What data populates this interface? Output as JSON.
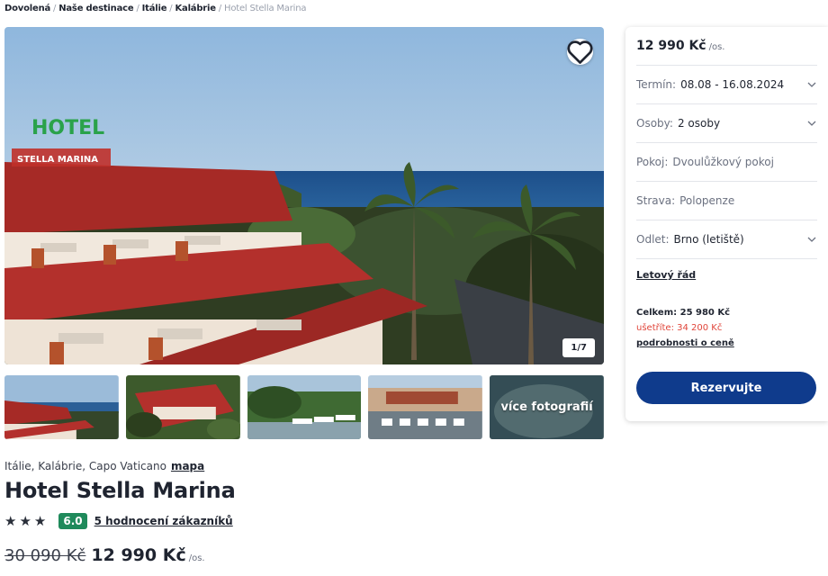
{
  "breadcrumb": {
    "items": [
      "Dovolená",
      "Naše destinace",
      "Itálie",
      "Kalábrie"
    ],
    "current": "Hotel Stella Marina",
    "separator": "/"
  },
  "gallery": {
    "counter": "1/7",
    "more_label": "více fotografií",
    "favorite_icon": "heart-icon",
    "sign_text": "HOTEL",
    "sign_subtext": "STELLA MARINA"
  },
  "hotel": {
    "location": "Itálie, Kalábrie, Capo Vaticano",
    "map_link": "mapa",
    "name": "Hotel Stella Marina",
    "stars": 3,
    "star_glyph": "★",
    "score": "6.0",
    "reviews": "5 hodnocení zákazníků",
    "old_price": "30 090 Kč",
    "price": "12 990 Kč",
    "per_person": "/os."
  },
  "booking": {
    "price": "12 990 Kč",
    "per_person": "/os.",
    "fields": {
      "term": {
        "label": "Termín:",
        "value": "08.08 - 16.08.2024"
      },
      "persons": {
        "label": "Osoby:",
        "value": "2 osoby"
      },
      "room": {
        "label": "Pokoj:",
        "value": "Dvoulůžkový pokoj"
      },
      "board": {
        "label": "Strava:",
        "value": "Polopenze"
      },
      "departure": {
        "label": "Odlet:",
        "value": "Brno (letiště)"
      }
    },
    "flight_schedule": "Letový řád",
    "total": "Celkem: 25 980 Kč",
    "savings": "ušetříte: 34 200 Kč",
    "price_details": "podrobnosti o ceně",
    "reserve": "Rezervujte"
  },
  "colors": {
    "primary": "#0f3b8c",
    "score_badge": "#1f8a5b",
    "savings": "#e0453a"
  }
}
